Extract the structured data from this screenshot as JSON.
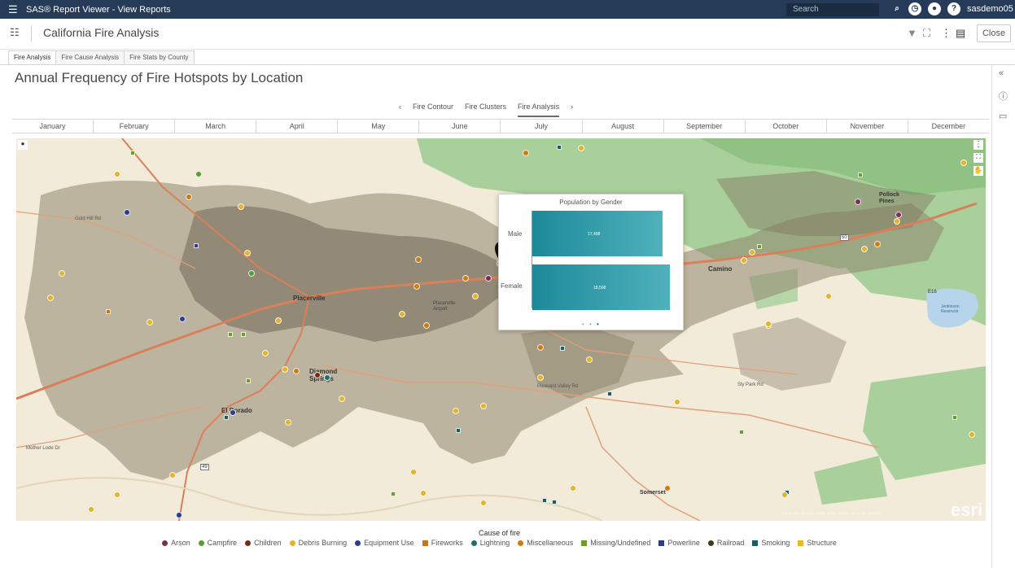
{
  "app": {
    "title": "SAS® Report Viewer - View Reports",
    "search_placeholder": "Search",
    "user": "sasdemo05"
  },
  "report": {
    "title": "California Fire Analysis",
    "close_label": "Close"
  },
  "tabs": [
    "Fire Analysis",
    "Fire Cause Analysis",
    "Fire Stats by County"
  ],
  "page_title": "Annual Frequency of Fire Hotspots by Location",
  "subnav": {
    "prev": "‹",
    "next": "›",
    "items": [
      "Fire Contour",
      "Fire Clusters",
      "Fire Analysis"
    ],
    "active_index": 2
  },
  "months": [
    "January",
    "February",
    "March",
    "April",
    "May",
    "June",
    "July",
    "August",
    "September",
    "October",
    "November",
    "December"
  ],
  "map": {
    "labels": [
      "Placerville",
      "Diamond Springs",
      "El Dorado",
      "Camino",
      "Pollock Pines",
      "Somerset",
      "Placerville Airport",
      "Gold Hill Rd",
      "Mother Lode Dr",
      "Pleasant Valley Rd",
      "50",
      "49",
      "E16",
      "Jenkinson Reservoir",
      "Sly Park Rd"
    ],
    "attribution": "Source: Esri, DeLorme, HERE, USGS, NRCAN, METI, iPC, TomTom",
    "esri_logo": "esri"
  },
  "popup": {
    "title": "Population by Gender",
    "rows": [
      {
        "label": "Male",
        "value": "17,498"
      },
      {
        "label": "Female",
        "value": "18,508"
      }
    ]
  },
  "legend": {
    "title": "Cause of fire",
    "items": [
      {
        "label": "Arson",
        "color": "#7b2d5c",
        "shape": "circle"
      },
      {
        "label": "Campfire",
        "color": "#5a9a37",
        "shape": "circle"
      },
      {
        "label": "Children",
        "color": "#7a2a10",
        "shape": "circle"
      },
      {
        "label": "Debris Burning",
        "color": "#e3b32c",
        "shape": "circle"
      },
      {
        "label": "Equipment Use",
        "color": "#2c3b8e",
        "shape": "circle"
      },
      {
        "label": "Fireworks",
        "color": "#c97416",
        "shape": "square"
      },
      {
        "label": "Lightning",
        "color": "#1f6e6b",
        "shape": "circle"
      },
      {
        "label": "Miscellaneous",
        "color": "#d07b12",
        "shape": "circle"
      },
      {
        "label": "Missing/Undefined",
        "color": "#6a9d2c",
        "shape": "square"
      },
      {
        "label": "Powerline",
        "color": "#2b3c8c",
        "shape": "square"
      },
      {
        "label": "Railroad",
        "color": "#3f3a18",
        "shape": "circle"
      },
      {
        "label": "Smoking",
        "color": "#1b5e60",
        "shape": "square"
      },
      {
        "label": "Structure",
        "color": "#e8b926",
        "shape": "square"
      }
    ]
  }
}
